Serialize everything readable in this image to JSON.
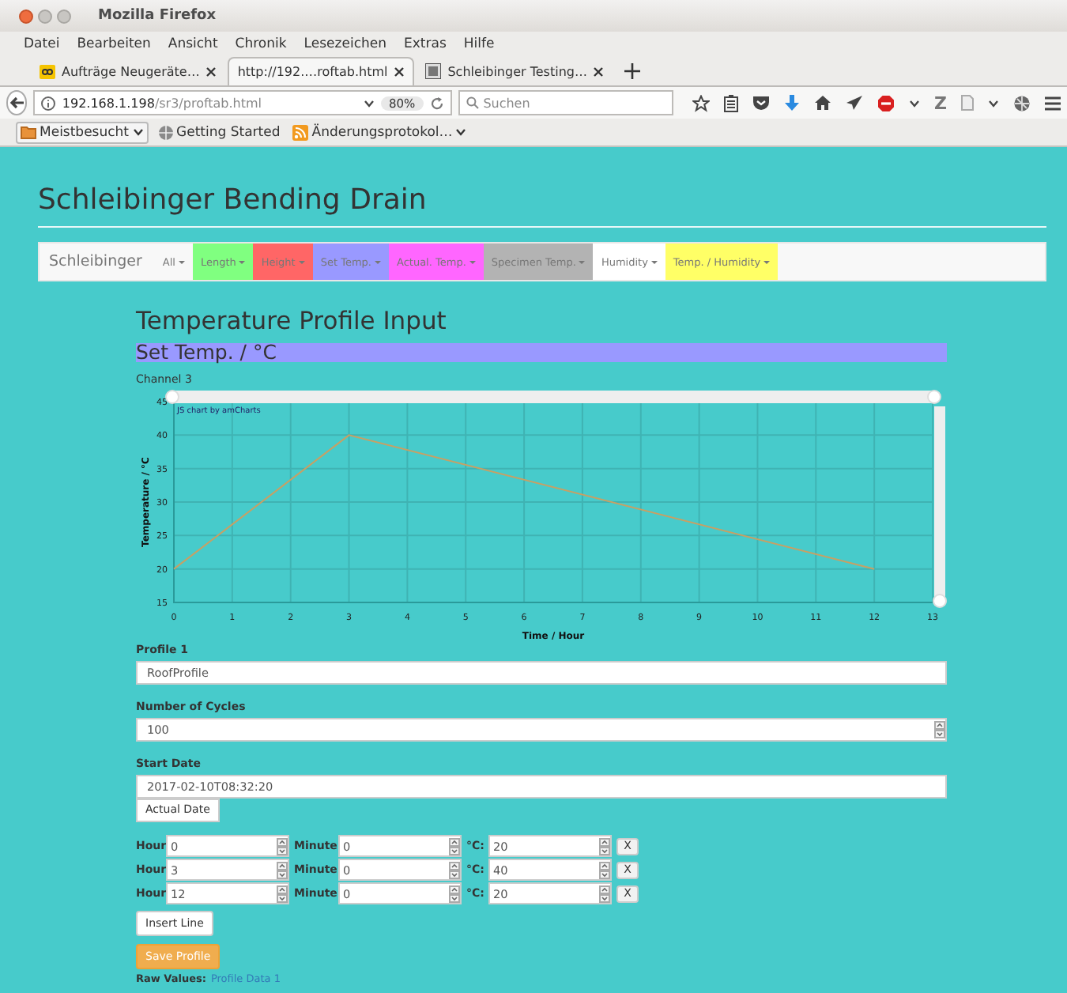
{
  "browser": {
    "title": "Mozilla Firefox",
    "menu": [
      "Datei",
      "Bearbeiten",
      "Ansicht",
      "Chronik",
      "Lesezeichen",
      "Extras",
      "Hilfe"
    ],
    "tabs": [
      {
        "label": "Aufträge Neugeräte…",
        "selected": false,
        "kind": "badge"
      },
      {
        "label": "http://192.…roftab.html",
        "selected": true,
        "kind": "none"
      },
      {
        "label": "Schleibinger Testing…",
        "selected": false,
        "kind": "photo"
      }
    ],
    "address": {
      "host": "192.168.1.198",
      "path": "/sr3/proftab.html",
      "zoom": "80%"
    },
    "search": {
      "placeholder": "Suchen"
    },
    "toolbar_letter": "Z",
    "bookmarks": [
      {
        "label": "Meistbesucht",
        "kind": "folder"
      },
      {
        "label": "Getting Started",
        "kind": "globe"
      },
      {
        "label": "Änderungsprotokol…",
        "kind": "feed"
      }
    ]
  },
  "page": {
    "title": "Schleibinger Bending Drain",
    "navbar": {
      "brand": "Schleibinger",
      "items": [
        {
          "label": "All",
          "color": "#f8f8f8"
        },
        {
          "label": "Length",
          "color": "#80ff80"
        },
        {
          "label": "Height",
          "color": "#ff6666"
        },
        {
          "label": "Set Temp.",
          "color": "#9999ff"
        },
        {
          "label": "Actual. Temp.",
          "color": "#ff66ff"
        },
        {
          "label": "Specimen Temp.",
          "color": "#b3b3b3"
        },
        {
          "label": "Humidity",
          "color": "#ffffff"
        },
        {
          "label": "Temp. / Humidity",
          "color": "#ffff66"
        }
      ]
    },
    "heading": "Temperature Profile Input",
    "panel": {
      "title": "Set Temp. / °C",
      "color": "#9999ff"
    },
    "channel": "Channel 3",
    "chart": {
      "credit": "JS chart by amCharts",
      "chart_data": {
        "type": "line",
        "grid": true,
        "xlabel": "Time / Hour",
        "ylabel": "Temperature / °C",
        "x": [
          0,
          3,
          12
        ],
        "series": [
          {
            "color": "#c8a064",
            "values": [
              20,
              40,
              20
            ]
          }
        ],
        "xlim": [
          0,
          13
        ],
        "ylim": [
          15,
          45
        ],
        "xticks": [
          0,
          1,
          2,
          3,
          4,
          5,
          6,
          7,
          8,
          9,
          10,
          11,
          12,
          13
        ],
        "yticks": [
          15,
          20,
          25,
          30,
          35,
          40,
          45
        ]
      }
    },
    "fields": [
      {
        "label": "Profile 1",
        "value": "RoofProfile",
        "kind": "text"
      },
      {
        "label": "Number of Cycles",
        "value": "100",
        "kind": "number"
      },
      {
        "label": "Start Date",
        "value": "2017-02-10T08:32:20",
        "kind": "text"
      }
    ],
    "date_button": "Actual Date",
    "rows": [
      {
        "cells": [
          {
            "label": "Hour",
            "value": "0"
          },
          {
            "label": "Minute",
            "value": "0"
          },
          {
            "label": "°C:",
            "value": "20"
          }
        ],
        "remove": "X"
      },
      {
        "cells": [
          {
            "label": "Hour",
            "value": "3"
          },
          {
            "label": "Minute",
            "value": "0"
          },
          {
            "label": "°C:",
            "value": "40"
          }
        ],
        "remove": "X"
      },
      {
        "cells": [
          {
            "label": "Hour",
            "value": "12"
          },
          {
            "label": "Minute",
            "value": "0"
          },
          {
            "label": "°C:",
            "value": "20"
          }
        ],
        "remove": "X"
      }
    ],
    "insert_button": "Insert Line",
    "save_button": "Save Profile",
    "raw_values": {
      "label": "Raw Values:",
      "link": "Profile Data 1"
    }
  }
}
